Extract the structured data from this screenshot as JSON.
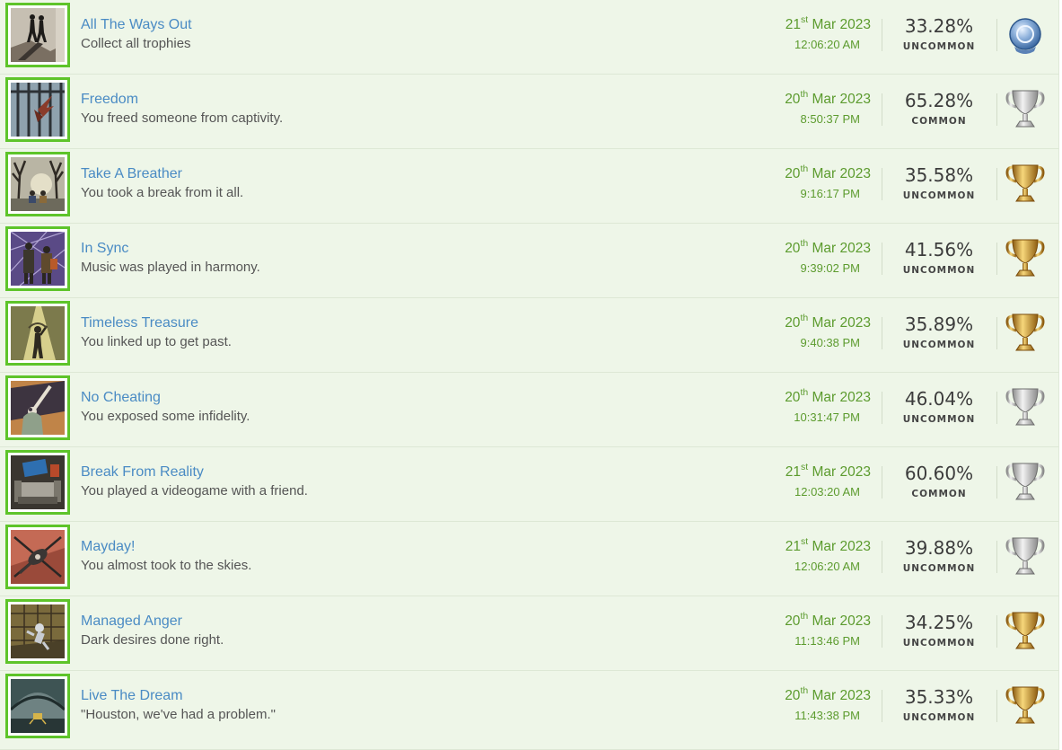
{
  "colors": {
    "background": "#eef6e8",
    "title": "#4a8bc4",
    "date": "#5c9b2e",
    "thumb_border": "#5ec42a"
  },
  "trophies": [
    {
      "title": "All The Ways Out",
      "description": "Collect all trophies",
      "day": "21",
      "ordinal": "st",
      "month_year": "Mar 2023",
      "time": "12:06:20 AM",
      "percent": "33.28%",
      "rarity": "UNCOMMON",
      "type": "platinum",
      "icon": "escape-silhouettes-icon"
    },
    {
      "title": "Freedom",
      "description": "You freed someone from captivity.",
      "day": "20",
      "ordinal": "th",
      "month_year": "Mar 2023",
      "time": "8:50:37 PM",
      "percent": "65.28%",
      "rarity": "COMMON",
      "type": "silver",
      "icon": "bird-in-cage-icon"
    },
    {
      "title": "Take A Breather",
      "description": "You took a break from it all.",
      "day": "20",
      "ordinal": "th",
      "month_year": "Mar 2023",
      "time": "9:16:17 PM",
      "percent": "35.58%",
      "rarity": "UNCOMMON",
      "type": "gold",
      "icon": "forest-rest-icon"
    },
    {
      "title": "In Sync",
      "description": "Music was played in harmony.",
      "day": "20",
      "ordinal": "th",
      "month_year": "Mar 2023",
      "time": "9:39:02 PM",
      "percent": "41.56%",
      "rarity": "UNCOMMON",
      "type": "gold",
      "icon": "musicians-icon"
    },
    {
      "title": "Timeless Treasure",
      "description": "You linked up to get past.",
      "day": "20",
      "ordinal": "th",
      "month_year": "Mar 2023",
      "time": "9:40:38 PM",
      "percent": "35.89%",
      "rarity": "UNCOMMON",
      "type": "gold",
      "icon": "light-beam-icon"
    },
    {
      "title": "No Cheating",
      "description": "You exposed some infidelity.",
      "day": "20",
      "ordinal": "th",
      "month_year": "Mar 2023",
      "time": "10:31:47 PM",
      "percent": "46.04%",
      "rarity": "UNCOMMON",
      "type": "silver",
      "icon": "bat-swing-icon"
    },
    {
      "title": "Break From Reality",
      "description": "You played a videogame with a friend.",
      "day": "21",
      "ordinal": "st",
      "month_year": "Mar 2023",
      "time": "12:03:20 AM",
      "percent": "60.60%",
      "rarity": "COMMON",
      "type": "silver",
      "icon": "couch-tv-icon"
    },
    {
      "title": "Mayday!",
      "description": "You almost took to the skies.",
      "day": "21",
      "ordinal": "st",
      "month_year": "Mar 2023",
      "time": "12:06:20 AM",
      "percent": "39.88%",
      "rarity": "UNCOMMON",
      "type": "silver",
      "icon": "helicopter-icon"
    },
    {
      "title": "Managed Anger",
      "description": "Dark desires done right.",
      "day": "20",
      "ordinal": "th",
      "month_year": "Mar 2023",
      "time": "11:13:46 PM",
      "percent": "34.25%",
      "rarity": "UNCOMMON",
      "type": "gold",
      "icon": "floating-astronaut-icon"
    },
    {
      "title": "Live The Dream",
      "description": "\"Houston, we've had a problem.\"",
      "day": "20",
      "ordinal": "th",
      "month_year": "Mar 2023",
      "time": "11:43:38 PM",
      "percent": "35.33%",
      "rarity": "UNCOMMON",
      "type": "gold",
      "icon": "moon-lander-icon"
    }
  ]
}
